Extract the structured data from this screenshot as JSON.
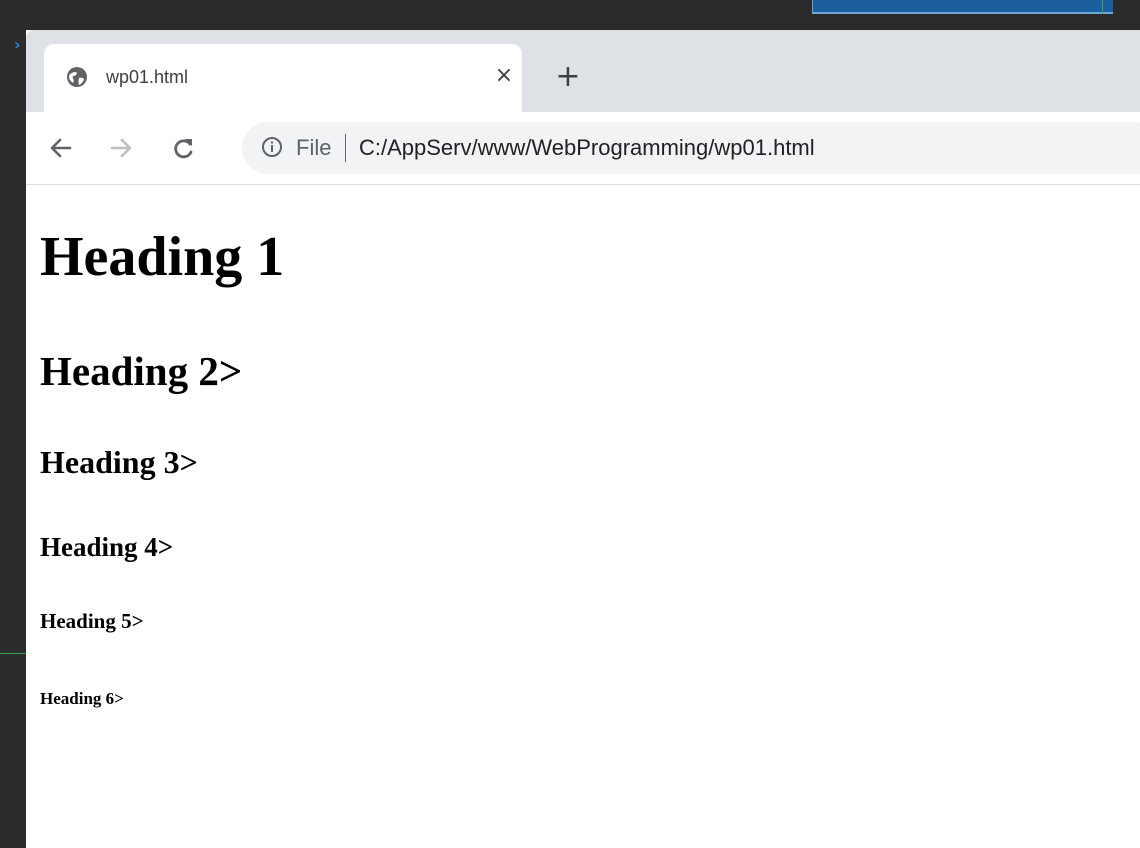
{
  "tab": {
    "title": "wp01.html",
    "close_glyph": "×",
    "favicon_icon": "globe-icon"
  },
  "tabstrip": {
    "new_tab_glyph": "+"
  },
  "toolbar": {
    "back_glyph": "←",
    "forward_glyph": "→",
    "reload_glyph": "C"
  },
  "omnibox": {
    "info_icon": "info-icon",
    "scheme_label": "File",
    "url": "C:/AppServ/www/WebProgramming/wp01.html"
  },
  "page": {
    "h1": "Heading 1",
    "h2": "Heading 2>",
    "h3": "Heading 3>",
    "h4": "Heading 4>",
    "h5": "Heading 5>",
    "h6": "Heading 6>"
  },
  "colors": {
    "tabstrip_bg": "#dee1e6",
    "omnibox_bg": "#f1f3f4",
    "icon_gray": "#5f6368",
    "disabled_gray": "#bdc1c6",
    "desktop_dark": "#2b2b2b"
  }
}
